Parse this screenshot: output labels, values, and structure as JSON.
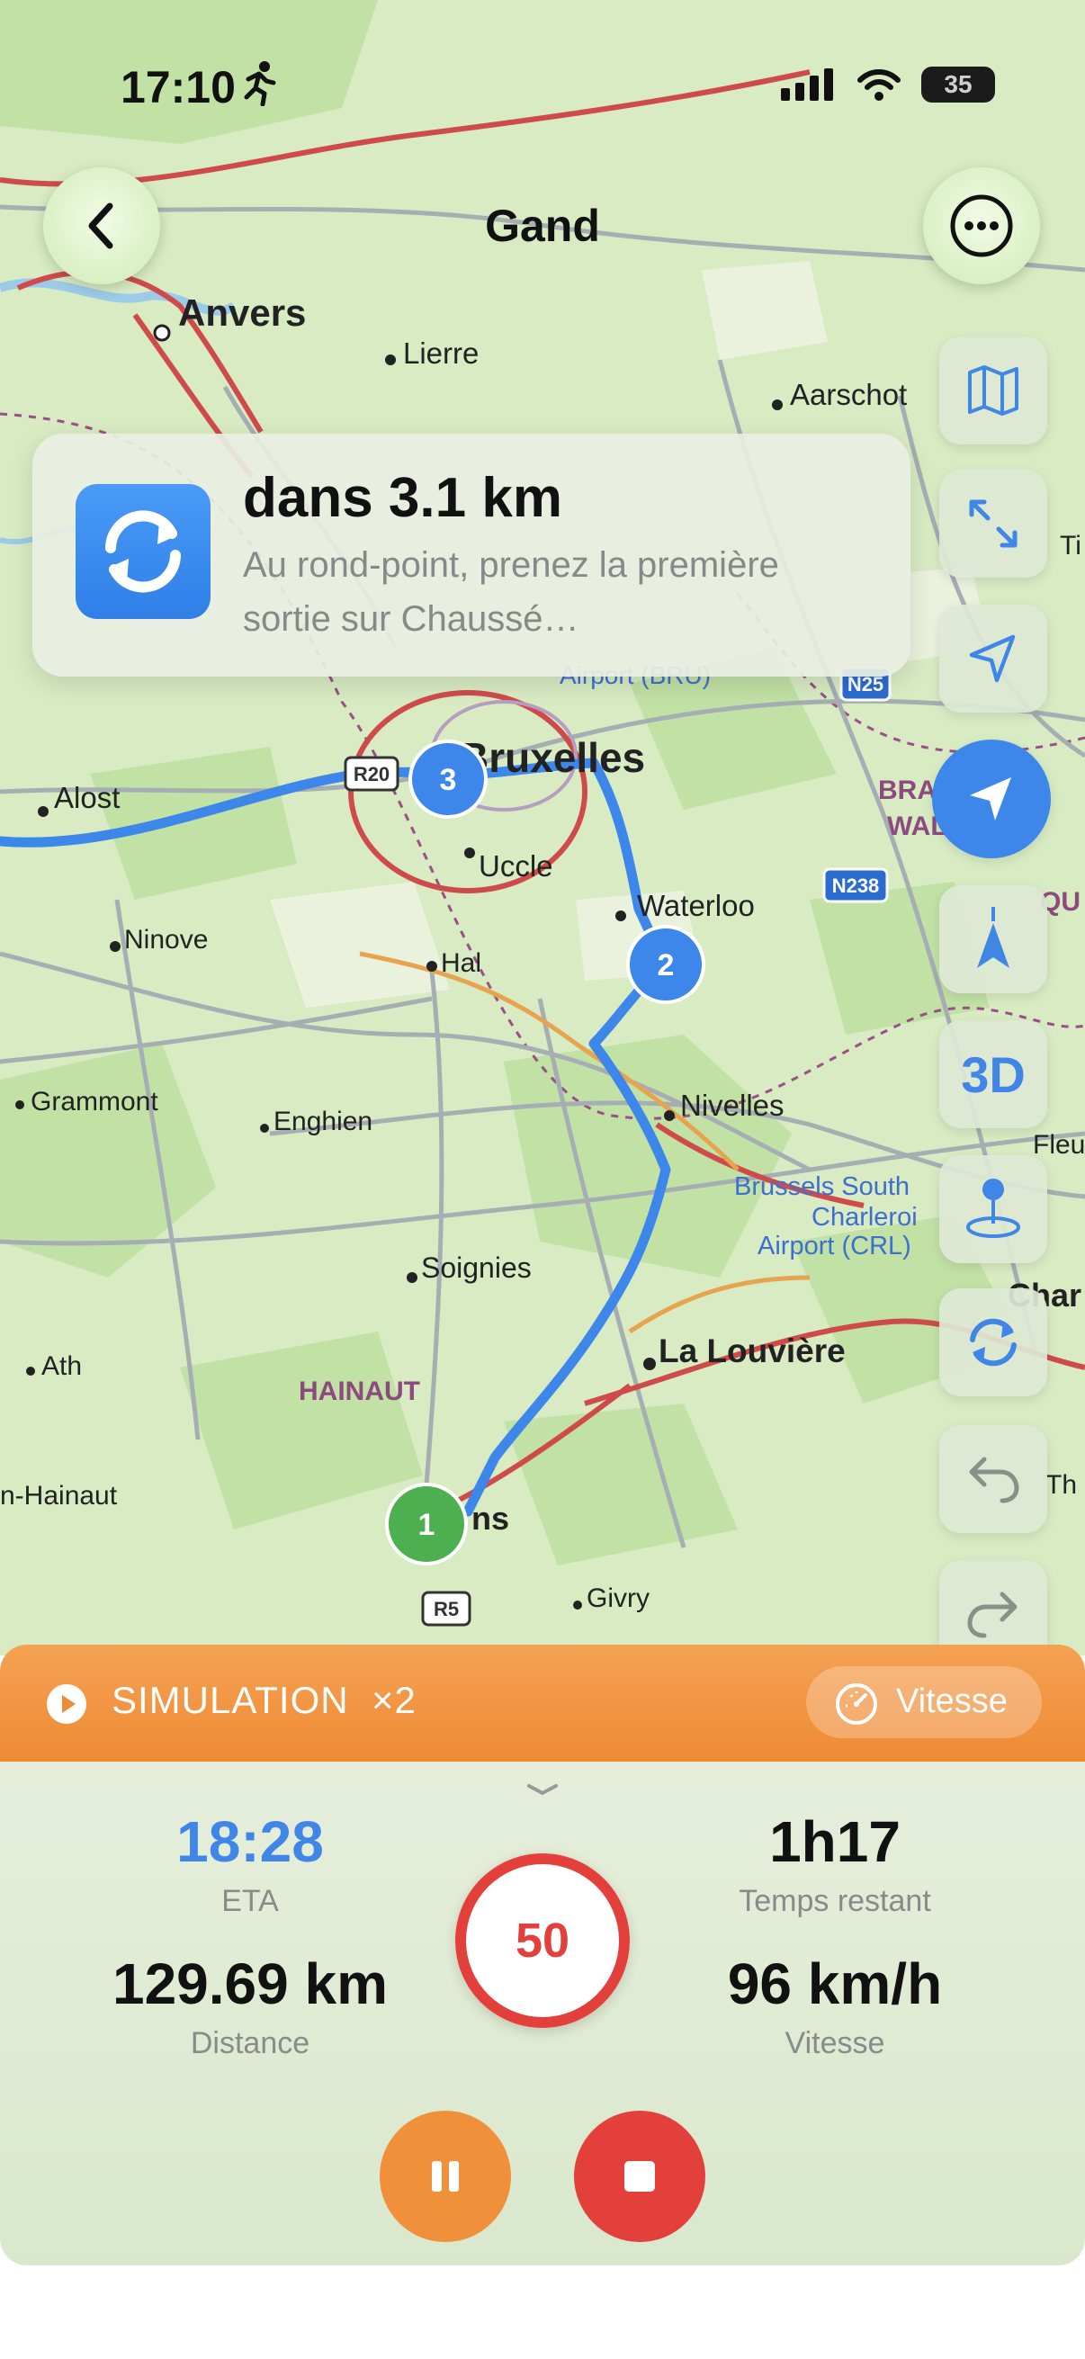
{
  "status_bar": {
    "time": "17:10",
    "battery": "35"
  },
  "header": {
    "title": "Gand"
  },
  "instruction": {
    "distance": "dans 3.1 km",
    "description": "Au rond-point, prenez la première sortie sur Chaussé…"
  },
  "map": {
    "labels": [
      "Anvers",
      "Lierre",
      "Aarschot",
      "Bruxelles",
      "Alost",
      "Uccle",
      "Waterloo",
      "Ninove",
      "Hal",
      "Nivelles",
      "Grammont",
      "Enghien",
      "Brussels South",
      "Charleroi",
      "Airport (CRL)",
      "Soignies",
      "HAINAUT",
      "La Louvière",
      "Ath",
      "n-Hainaut",
      "ns",
      "Givry",
      "Ti",
      "Fleu",
      "Char",
      "Th",
      "BRA",
      "WAL",
      "QU",
      "Airport (BRU)"
    ],
    "road_shields": [
      "N25",
      "R20",
      "N238",
      "R5"
    ],
    "waypoints": [
      "1",
      "2",
      "3"
    ]
  },
  "side_controls": [
    "map-icon",
    "expand-icon",
    "navigation-arrow-icon",
    "navigation-active-icon",
    "compass-icon",
    "3D",
    "pin-icon",
    "rotate-icon",
    "undo-icon",
    "redo-icon"
  ],
  "simulation": {
    "label": "SIMULATION",
    "multiplier": "×2",
    "speed_button": "Vitesse"
  },
  "stats": {
    "eta_value": "18:28",
    "eta_label": "ETA",
    "remaining_value": "1h17",
    "remaining_label": "Temps restant",
    "distance_value": "129.69 km",
    "distance_label": "Distance",
    "speed_value": "96 km/h",
    "speed_label": "Vitesse",
    "speed_limit": "50"
  },
  "colors": {
    "route": "#3d87ea",
    "accent": "#3f86e6",
    "simulation": "#f08c38",
    "stop": "#e4403b",
    "pause": "#f0903a",
    "start_marker": "#4caf50"
  }
}
